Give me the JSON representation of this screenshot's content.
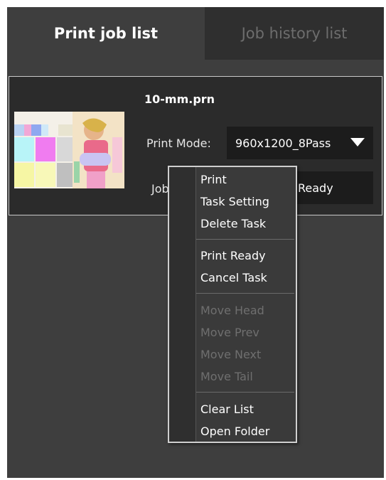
{
  "tabs": {
    "active_label": "Print job list",
    "inactive_label": "Job history list"
  },
  "job": {
    "file_name": "10-mm.prn",
    "print_mode_label": "Print Mode:",
    "print_mode_value": "960x1200_8Pass",
    "status_label_partial": "Job",
    "status_value_partial": "Ready"
  },
  "context_menu": {
    "items": [
      {
        "label": "Print",
        "enabled": true
      },
      {
        "label": "Task Setting",
        "enabled": true
      },
      {
        "label": "Delete Task",
        "enabled": true
      },
      {
        "label": "Print Ready",
        "enabled": true
      },
      {
        "label": "Cancel Task",
        "enabled": true
      },
      {
        "label": "Move Head",
        "enabled": false
      },
      {
        "label": "Move Prev",
        "enabled": false
      },
      {
        "label": "Move Next",
        "enabled": false
      },
      {
        "label": "Move Tail",
        "enabled": false
      },
      {
        "label": "Clear List",
        "enabled": true
      },
      {
        "label": "Open Folder",
        "enabled": true
      }
    ]
  },
  "colors": {
    "panel_bg": "#3e3e3e",
    "card_bg": "#2b2b2b",
    "field_bg": "#1c1c1c",
    "text": "#ffffff",
    "disabled_text": "#6f6f6f"
  },
  "icons": {
    "dropdown": "chevron-down-icon",
    "thumbnail": "print-preview-thumbnail"
  }
}
